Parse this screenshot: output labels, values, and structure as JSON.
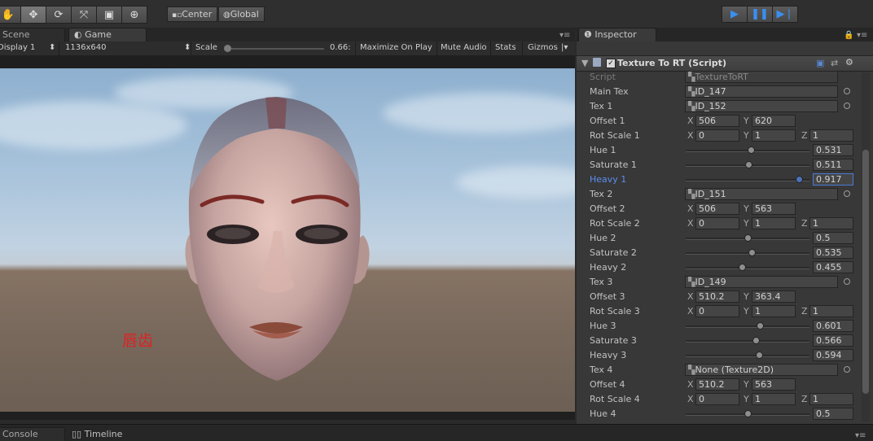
{
  "toolbar": {
    "tools": [
      "hand-tool",
      "move-tool",
      "rotate-tool",
      "scale-tool",
      "rect-tool",
      "transform-tool"
    ],
    "pivot_label": "Center",
    "space_label": "Global",
    "play_controls": [
      "play",
      "pause",
      "step"
    ]
  },
  "tabs": {
    "scene": "Scene",
    "game": "Game",
    "inspector": "Inspector",
    "console": "Console",
    "timeline": "Timeline"
  },
  "game_bar": {
    "display": "Display 1",
    "resolution": "1136x640",
    "scale_label": "Scale",
    "scale_value": "0.66:",
    "maximize": "Maximize On Play",
    "mute": "Mute Audio",
    "stats": "Stats",
    "gizmos": "Gizmos"
  },
  "game_view": {
    "label": "唇齿"
  },
  "component": {
    "title": "Texture To RT (Script)",
    "enabled": true
  },
  "fields": {
    "script": {
      "label": "Script",
      "value": "TextureToRT"
    },
    "main_tex": {
      "label": "Main Tex",
      "value": "ID_147"
    },
    "tex1": {
      "label": "Tex 1",
      "value": "ID_152"
    },
    "offset1": {
      "label": "Offset 1",
      "x": "506",
      "y": "620"
    },
    "rot_scale1": {
      "label": "Rot Scale 1",
      "x": "0",
      "y": "1",
      "z": "1"
    },
    "hue1": {
      "label": "Hue 1",
      "value": "0.531"
    },
    "saturate1": {
      "label": "Saturate 1",
      "value": "0.511"
    },
    "heavy1": {
      "label": "Heavy 1",
      "value": "0.917"
    },
    "tex2": {
      "label": "Tex 2",
      "value": "ID_151"
    },
    "offset2": {
      "label": "Offset 2",
      "x": "506",
      "y": "563"
    },
    "rot_scale2": {
      "label": "Rot Scale 2",
      "x": "0",
      "y": "1",
      "z": "1"
    },
    "hue2": {
      "label": "Hue 2",
      "value": "0.5"
    },
    "saturate2": {
      "label": "Saturate 2",
      "value": "0.535"
    },
    "heavy2": {
      "label": "Heavy 2",
      "value": "0.455"
    },
    "tex3": {
      "label": "Tex 3",
      "value": "ID_149"
    },
    "offset3": {
      "label": "Offset 3",
      "x": "510.2",
      "y": "363.4"
    },
    "rot_scale3": {
      "label": "Rot Scale 3",
      "x": "0",
      "y": "1",
      "z": "1"
    },
    "hue3": {
      "label": "Hue 3",
      "value": "0.601"
    },
    "saturate3": {
      "label": "Saturate 3",
      "value": "0.566"
    },
    "heavy3": {
      "label": "Heavy 3",
      "value": "0.594"
    },
    "tex4": {
      "label": "Tex 4",
      "value": "None (Texture2D)"
    },
    "offset4": {
      "label": "Offset 4",
      "x": "510.2",
      "y": "563"
    },
    "rot_scale4": {
      "label": "Rot Scale 4",
      "x": "0",
      "y": "1",
      "z": "1"
    },
    "hue4": {
      "label": "Hue 4",
      "value": "0.5"
    }
  },
  "axis_letters": {
    "x": "X",
    "y": "Y",
    "z": "Z"
  }
}
